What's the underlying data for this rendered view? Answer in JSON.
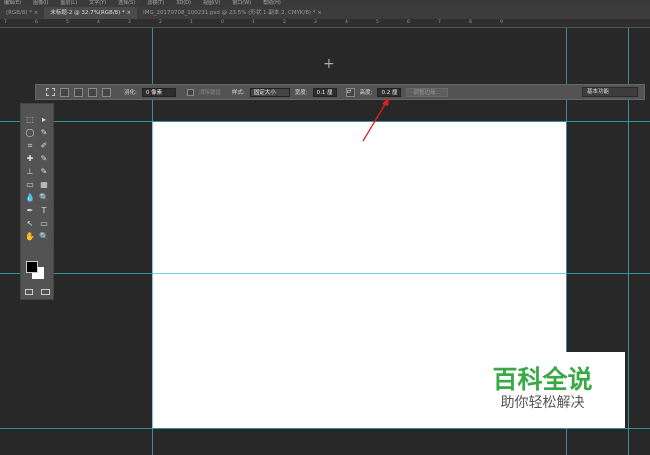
{
  "menu": [
    "编辑(E)",
    "图像(I)",
    "图层(L)",
    "文字(Y)",
    "选择(S)",
    "滤镜(T)",
    "3D(D)",
    "视图(V)",
    "窗口(W)",
    "帮助(H)"
  ],
  "tabs": [
    {
      "label": "(RGB/8) *  ×"
    },
    {
      "label": "未标题-2 @ 32.7%(RGB/8) *  ×"
    },
    {
      "label": "IMG_20170708_100231.psd @ 23.5% (形状 1 副本 2, CMYK/8) *  ×"
    }
  ],
  "ruler": [
    "7",
    "6",
    "5",
    "4",
    "3",
    "2",
    "1",
    "0",
    "1",
    "2",
    "3",
    "4",
    "5",
    "6",
    "7",
    "8",
    "9"
  ],
  "options": {
    "feather_label": "羽化:",
    "feather_value": "0 像素",
    "antialias_label": "消除锯齿",
    "style_label": "样式:",
    "style_value": "固定大小",
    "width_label": "宽度:",
    "width_value": "0.1 厘",
    "height_label": "高度:",
    "height_value": "0.2 厘",
    "refine_label": "调整边缘...",
    "workspace": "基本功能"
  },
  "tools": [
    "⬚",
    "▸",
    "◯",
    "✎",
    "⌗",
    "✐",
    "✚",
    "✎",
    "⊥",
    "✎",
    "▭",
    "▦",
    "💧",
    "🔍",
    "✒",
    "T",
    "↖",
    "▭",
    "✋",
    "🔍"
  ],
  "watermark": {
    "title": "百科全说",
    "subtitle": "助你轻松解决"
  }
}
